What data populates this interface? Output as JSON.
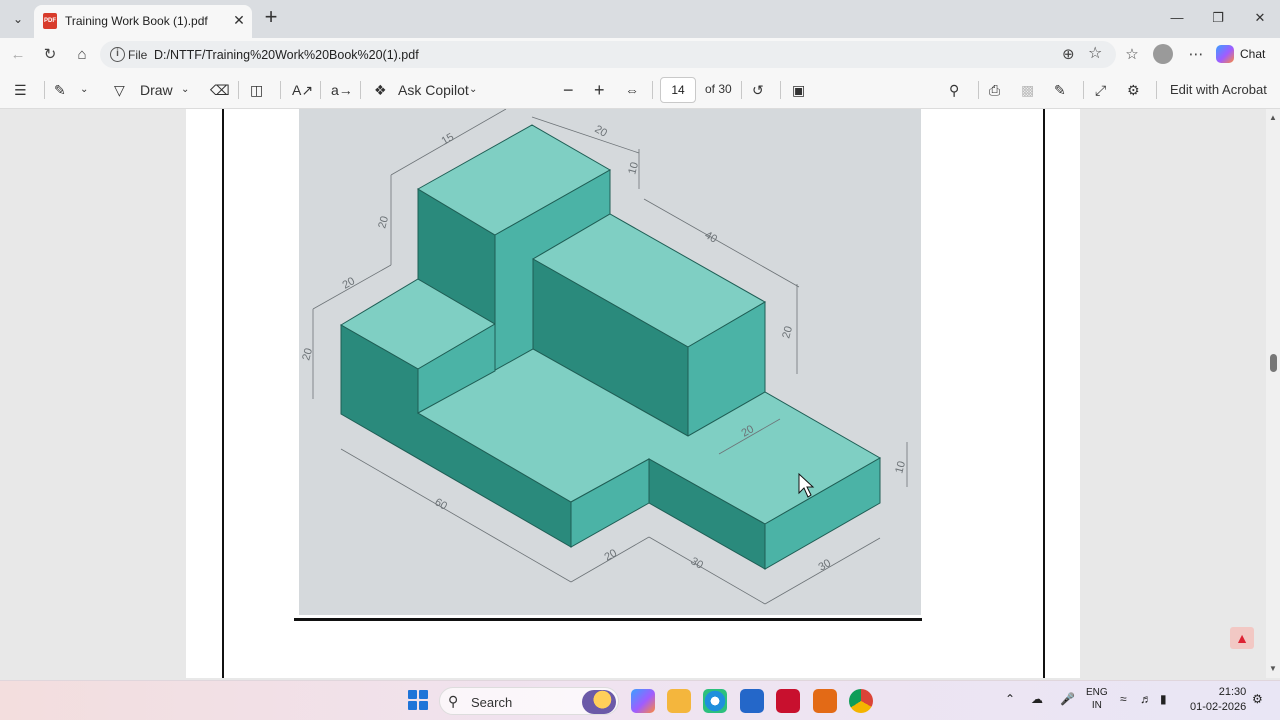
{
  "browser": {
    "tab": {
      "title": "Training Work Book (1).pdf",
      "favicon": "pdf-icon"
    },
    "address": {
      "scheme_label": "File",
      "url": "D:/NTTF/Training%20Work%20Book%20(1).pdf"
    },
    "copilot_label": "Chat"
  },
  "pdf_toolbar": {
    "draw_label": "Draw",
    "ask_copilot_label": "Ask Copilot",
    "page_current": "14",
    "page_total": "of 30",
    "edit_label": "Edit with Acrobat"
  },
  "drawing": {
    "dimensions": [
      "15",
      "20",
      "10",
      "20",
      "40",
      "20",
      "20",
      "20",
      "20",
      "10",
      "60",
      "20",
      "30",
      "30"
    ],
    "colors": {
      "top_face": "#7fcfc3",
      "front_face": "#2a8a7c",
      "side_face": "#4bb3a6",
      "background": "#d5d9dc"
    }
  },
  "taskbar": {
    "search_label": "Search",
    "lang_line1": "ENG",
    "lang_line2": "IN",
    "time": "21:30",
    "date": "01-02-2026"
  }
}
